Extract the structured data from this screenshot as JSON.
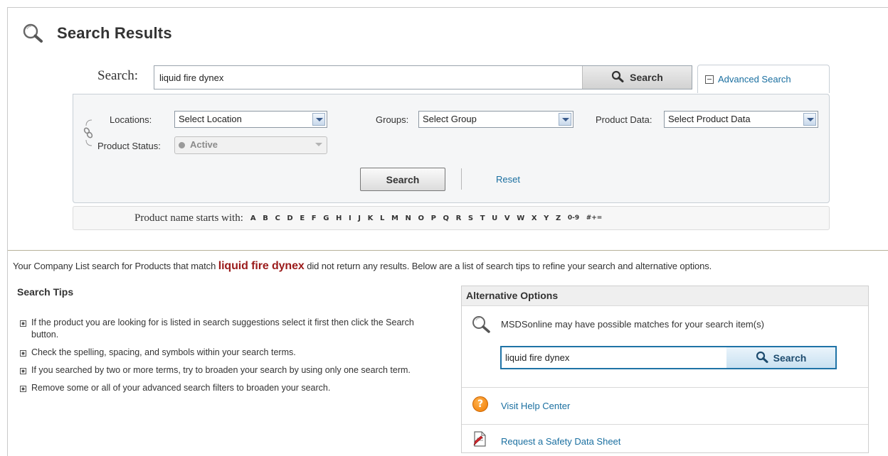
{
  "page": {
    "title": "Search Results"
  },
  "search": {
    "label": "Search:",
    "value": "liquid fire dynex",
    "button_label": "Search",
    "advanced_link": "Advanced Search"
  },
  "advanced": {
    "locations_label": "Locations:",
    "locations_value": "Select Location",
    "groups_label": "Groups:",
    "groups_value": "Select Group",
    "product_data_label": "Product Data:",
    "product_data_value": "Select Product Data",
    "status_label": "Product Status:",
    "status_value": "Active",
    "search_button": "Search",
    "reset_link": "Reset"
  },
  "alpha": {
    "label": "Product name starts with:",
    "letters": [
      "A",
      "B",
      "C",
      "D",
      "E",
      "F",
      "G",
      "H",
      "I",
      "J",
      "K",
      "L",
      "M",
      "N",
      "O",
      "P",
      "Q",
      "R",
      "S",
      "T",
      "U",
      "V",
      "W",
      "X",
      "Y",
      "Z",
      "0-9",
      "#+="
    ]
  },
  "message": {
    "before": "Your Company List search for Products that match ",
    "term": "liquid fire dynex",
    "after": " did not return any results. Below are a list of search tips to refine your search and alternative options."
  },
  "tips": {
    "title": "Search Tips",
    "items": [
      "If the product you are looking for is listed in search suggestions select it first then click the Search button.",
      "Check the spelling, spacing, and symbols within your search terms.",
      "If you searched by two or more terms, try to broaden your search by using only one search term.",
      "Remove some or all of your advanced search filters to broaden your search."
    ]
  },
  "alternatives": {
    "title": "Alternative Options",
    "msds_text": "MSDSonline may have possible matches for your search item(s)",
    "msds_value": "liquid fire dynex",
    "msds_button": "Search",
    "help_link": "Visit Help Center",
    "sds_link": "Request a Safety Data Sheet"
  },
  "icons": {
    "title": "magnifier-icon",
    "search_button": "magnifier-icon",
    "chain": "link-icon",
    "advanced_toggle": "minus-box-icon",
    "help": "question-mark-icon",
    "sds": "document-pen-icon"
  },
  "colors": {
    "link": "#1a6fa0",
    "term": "#9b1b1b",
    "help_orange": "#f07b00",
    "alt_search_border": "#1f73a6"
  }
}
